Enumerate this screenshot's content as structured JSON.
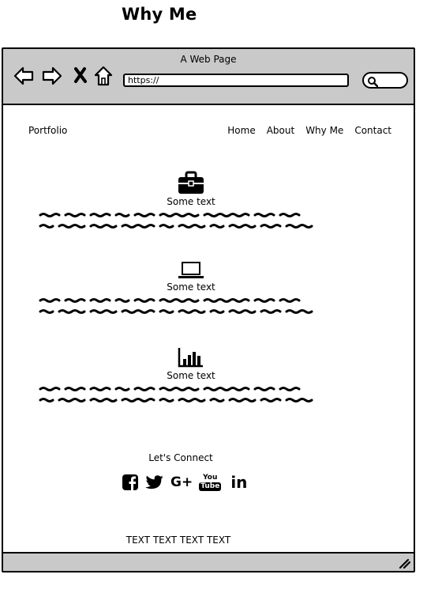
{
  "page": {
    "title": "Why Me"
  },
  "browser": {
    "window_title": "A Web Page",
    "url": "https://",
    "icons": [
      "back-arrow-icon",
      "forward-arrow-icon",
      "close-x-icon",
      "home-icon",
      "search-icon",
      "resize-grip-icon"
    ]
  },
  "site": {
    "brand": "Portfolio",
    "nav": {
      "home": "Home",
      "about": "About",
      "why_me": "Why Me",
      "contact": "Contact"
    }
  },
  "features": [
    {
      "icon": "briefcase-icon",
      "label": "Some text"
    },
    {
      "icon": "laptop-icon",
      "label": "Some text"
    },
    {
      "icon": "bar-chart-icon",
      "label": "Some text"
    }
  ],
  "connect": {
    "title": "Let's Connect",
    "icons": [
      "facebook-icon",
      "twitter-icon",
      "google-plus-icon",
      "youtube-icon",
      "linkedin-icon"
    ],
    "google_plus_label": "G+",
    "youtube_top": "You",
    "youtube_bottom": "Tube",
    "linkedin_label": "in"
  },
  "footer": {
    "text": "TEXT TEXT TEXT TEXT"
  },
  "colors": {
    "chrome": "#c9c9c9",
    "ink": "#000000",
    "background": "#ffffff"
  }
}
